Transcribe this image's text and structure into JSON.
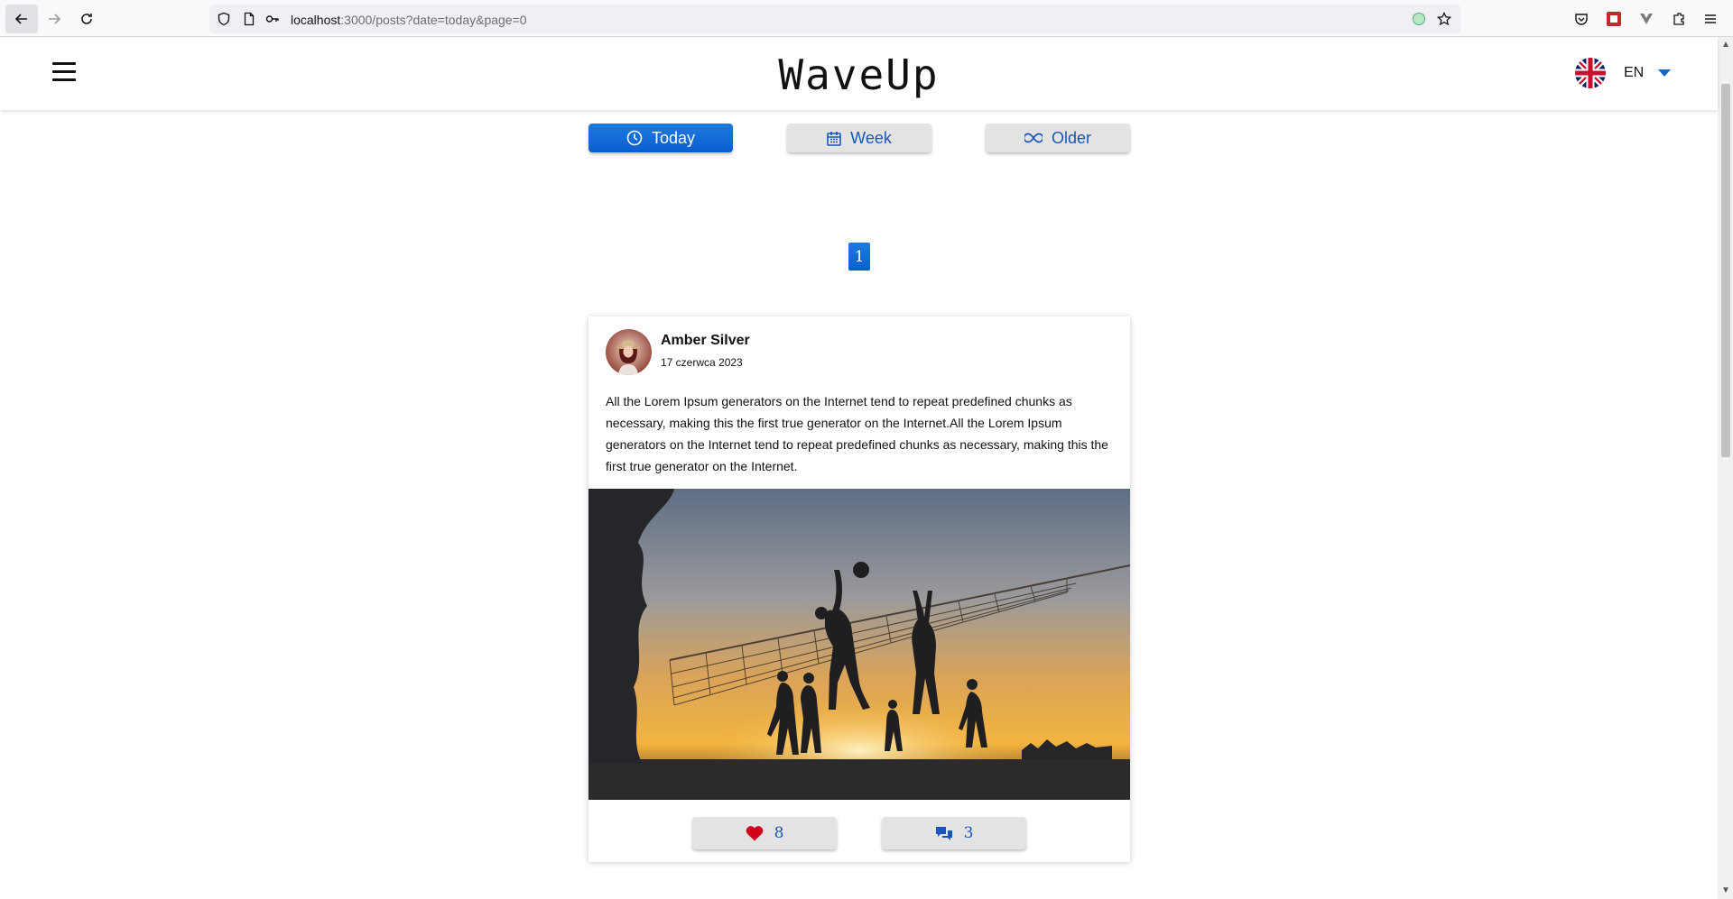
{
  "browser": {
    "url_host": "localhost",
    "url_rest": ":3000/posts?date=today&page=0"
  },
  "header": {
    "logo": "WaveUp",
    "language": "EN"
  },
  "filters": {
    "today": "Today",
    "week": "Week",
    "older": "Older",
    "active": "today"
  },
  "pagination": {
    "current_page": "1"
  },
  "post": {
    "author": "Amber Silver",
    "date": "17 czerwca 2023",
    "text": "All the Lorem Ipsum generators on the Internet tend to repeat predefined chunks as necessary, making this the first true generator on the Internet.All the Lorem Ipsum generators on the Internet tend to repeat predefined chunks as necessary, making this the first true generator on the Internet.",
    "likes": "8",
    "comments": "3"
  },
  "colors": {
    "accent": "#1a64c8",
    "like": "#d0021b"
  },
  "icons": {
    "today": "clock-icon",
    "week": "calendar-icon",
    "older": "infinity-icon",
    "like": "heart-icon",
    "comments": "comments-icon"
  }
}
